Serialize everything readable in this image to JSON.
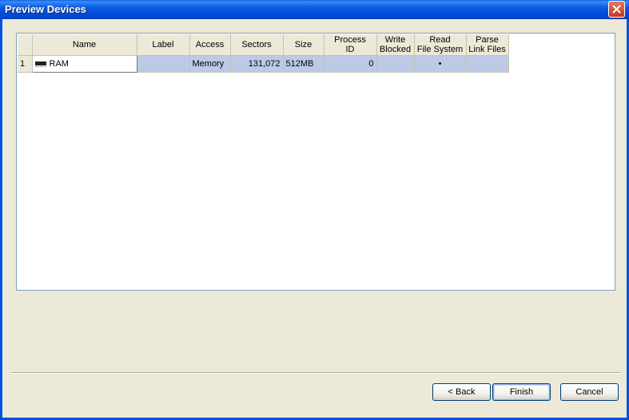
{
  "window": {
    "title": "Preview Devices"
  },
  "grid": {
    "columns": [
      "",
      "Name",
      "Label",
      "Access",
      "Sectors",
      "Size",
      "Process\nID",
      "Write\nBlocked",
      "Read\nFile System",
      "Parse\nLink Files"
    ],
    "column_lines": [
      [
        ""
      ],
      [
        "Name"
      ],
      [
        "Label"
      ],
      [
        "Access"
      ],
      [
        "Sectors"
      ],
      [
        "Size"
      ],
      [
        "Process",
        "ID"
      ],
      [
        "Write",
        "Blocked"
      ],
      [
        "Read",
        "File System"
      ],
      [
        "Parse",
        "Link Files"
      ]
    ],
    "rows": [
      {
        "num": "1",
        "icon": "ram-chip-icon",
        "name": "RAM",
        "label": "",
        "access": "Memory",
        "sectors": "131,072",
        "size": "512MB",
        "process_id": "0",
        "write_blocked": "",
        "read_file_system": "•",
        "parse_link_files": ""
      }
    ]
  },
  "buttons": {
    "back": "< Back",
    "finish": "Finish",
    "cancel": "Cancel"
  },
  "colors": {
    "title_bar": "#0054e3",
    "row_highlight": "#bccae8",
    "window_bg": "#ece9d8"
  }
}
